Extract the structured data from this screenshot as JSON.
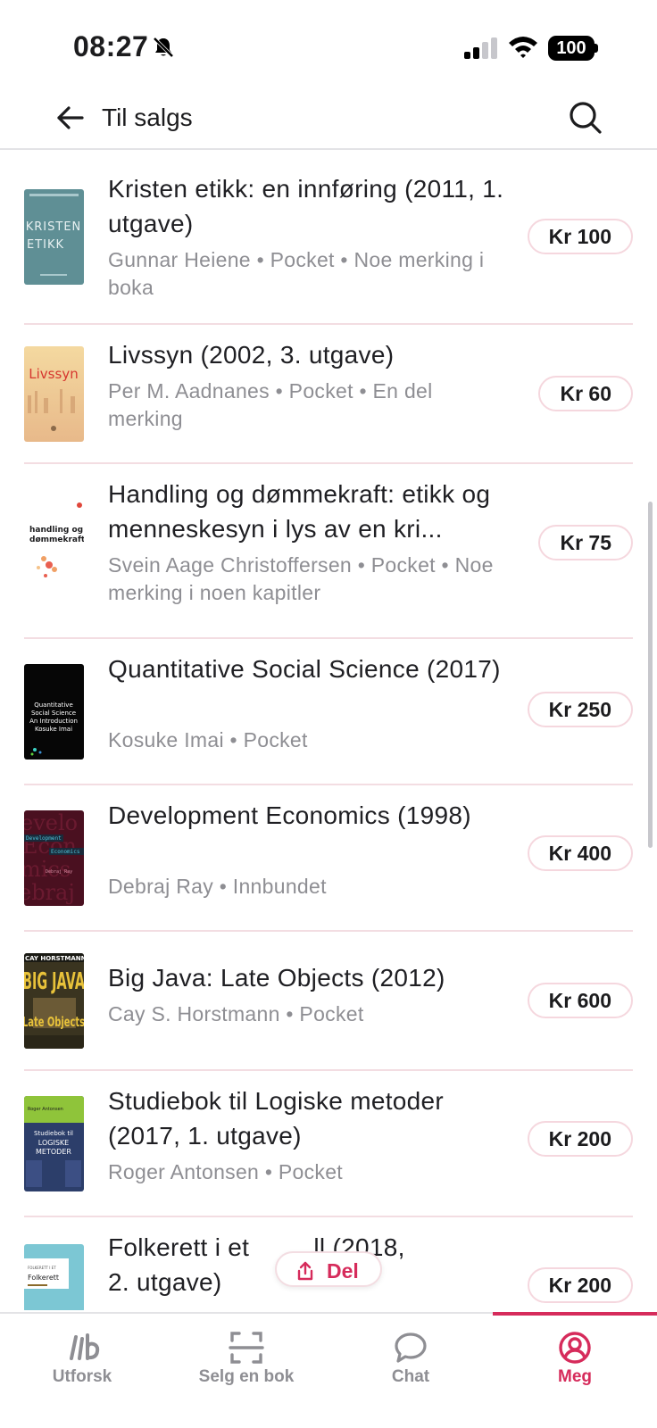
{
  "status_bar": {
    "time": "08:27",
    "battery": "100"
  },
  "header": {
    "title": "Til salgs"
  },
  "books": [
    {
      "title": "Kristen etikk: en innføring (2011, 1. utgave)",
      "meta": "Gunnar Heiene • Pocket • Noe merking i boka",
      "price": "Kr 100",
      "cover_text": "KRISTEN ETIKK"
    },
    {
      "title": "Livssyn (2002, 3. utgave)",
      "meta": "Per M. Aadnanes • Pocket • En del merking",
      "price": "Kr 60",
      "cover_text": "Livssyn"
    },
    {
      "title": "Handling og dømmekraft: etikk og menneskesyn i lys av en kri...",
      "meta": "Svein Aage Christoffersen • Pocket • Noe merking i noen kapitler",
      "price": "Kr 75",
      "cover_text": "handling og dømmekraft"
    },
    {
      "title": "Quantitative Social Science (2017)",
      "meta": "Kosuke Imai • Pocket",
      "price": "Kr 250",
      "cover_text": "Quantitative Social Science An Introduction Kosuke Imai"
    },
    {
      "title": "Development Economics (1998)",
      "meta": "Debraj Ray • Innbundet",
      "price": "Kr 400",
      "cover_text": "Development Economics"
    },
    {
      "title": "Big Java: Late Objects (2012)",
      "meta": "Cay S. Horstmann • Pocket",
      "price": "Kr 600",
      "cover_text": "BIG JAVA Late Objects"
    },
    {
      "title": "Studiebok til Logiske metoder (2017, 1. utgave)",
      "meta": "Roger Antonsen • Pocket",
      "price": "Kr 200",
      "cover_text": "Studiebok til LOGISKE METODER"
    },
    {
      "title": "Folkerett i et n... (2018, 2. utgave)",
      "title_line1_left": "Folkerett i et ",
      "title_line1_right": "ll (2018,",
      "title_line2": "2. utgave)",
      "meta": "",
      "price": "Kr 200",
      "cover_text": "Folkerett"
    }
  ],
  "share": {
    "label": "Del"
  },
  "tabs": [
    {
      "label": "Utforsk",
      "icon": "explore-icon",
      "active": false
    },
    {
      "label": "Selg en bok",
      "icon": "scan-icon",
      "active": false
    },
    {
      "label": "Chat",
      "icon": "chat-icon",
      "active": false
    },
    {
      "label": "Meg",
      "icon": "profile-icon",
      "active": true
    }
  ],
  "colors": {
    "accent": "#d62b5b",
    "divider": "#f3dde2",
    "muted": "#8e8e93"
  }
}
